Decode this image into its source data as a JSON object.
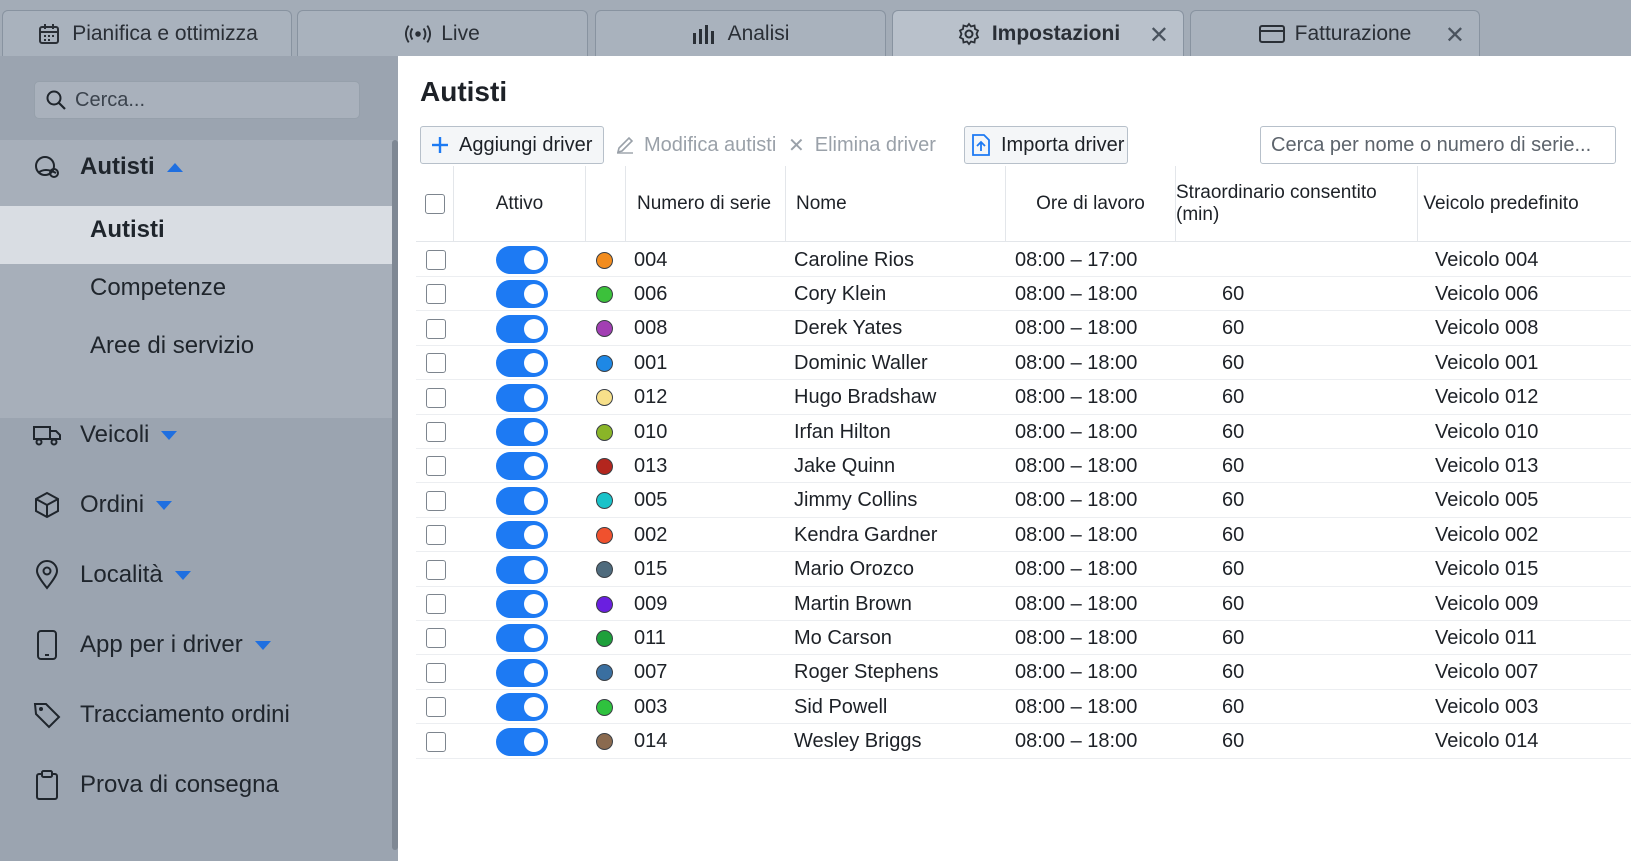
{
  "tabs": [
    {
      "label": "Pianifica e ottimizza",
      "icon": "calendar-icon",
      "closable": false
    },
    {
      "label": "Live",
      "icon": "broadcast-icon",
      "closable": false
    },
    {
      "label": "Analisi",
      "icon": "bar-chart-icon",
      "closable": false
    },
    {
      "label": "Impostazioni",
      "icon": "gear-icon",
      "closable": true,
      "active": true
    },
    {
      "label": "Fatturazione",
      "icon": "credit-card-icon",
      "closable": true
    }
  ],
  "sidebar": {
    "search_placeholder": "Cerca...",
    "group": {
      "label": "Autisti",
      "icon": "drivers-icon",
      "expanded": true
    },
    "sub_items": [
      {
        "label": "Autisti",
        "active": true
      },
      {
        "label": "Competenze"
      },
      {
        "label": "Aree di servizio"
      }
    ],
    "items": [
      {
        "label": "Veicoli",
        "icon": "truck-icon",
        "has_caret": true
      },
      {
        "label": "Ordini",
        "icon": "box-icon",
        "has_caret": true
      },
      {
        "label": "Località",
        "icon": "location-pin-icon",
        "has_caret": true
      },
      {
        "label": "App per i driver",
        "icon": "phone-icon",
        "has_caret": true
      },
      {
        "label": "Tracciamento ordini",
        "icon": "tag-icon",
        "has_caret": false
      },
      {
        "label": "Prova di consegna",
        "icon": "clipboard-icon",
        "has_caret": false
      }
    ]
  },
  "main": {
    "title": "Autisti",
    "toolbar": {
      "add_label": "Aggiungi driver",
      "edit_label": "Modifica autisti",
      "delete_label": "Elimina driver",
      "import_label": "Importa driver",
      "search_placeholder": "Cerca per nome o numero di serie..."
    },
    "columns": {
      "active": "Attivo",
      "serial": "Numero di serie",
      "name": "Nome",
      "hours": "Ore di lavoro",
      "overtime": "Straordinario consentito (min)",
      "vehicle": "Veicolo predefinito"
    },
    "rows": [
      {
        "color": "#f28c1e",
        "serial": "004",
        "name": "Caroline Rios",
        "hours": "08:00 – 17:00",
        "overtime": "",
        "vehicle": "Veicolo 004"
      },
      {
        "color": "#3cc13b",
        "serial": "006",
        "name": "Cory Klein",
        "hours": "08:00 – 18:00",
        "overtime": "60",
        "vehicle": "Veicolo 006"
      },
      {
        "color": "#a23fb3",
        "serial": "008",
        "name": "Derek Yates",
        "hours": "08:00 – 18:00",
        "overtime": "60",
        "vehicle": "Veicolo 008"
      },
      {
        "color": "#1e88e5",
        "serial": "001",
        "name": "Dominic Waller",
        "hours": "08:00 – 18:00",
        "overtime": "60",
        "vehicle": "Veicolo 001"
      },
      {
        "color": "#f7e08a",
        "serial": "012",
        "name": "Hugo Bradshaw",
        "hours": "08:00 – 18:00",
        "overtime": "60",
        "vehicle": "Veicolo 012"
      },
      {
        "color": "#8ab528",
        "serial": "010",
        "name": "Irfan Hilton",
        "hours": "08:00 – 18:00",
        "overtime": "60",
        "vehicle": "Veicolo 010"
      },
      {
        "color": "#b3261e",
        "serial": "013",
        "name": "Jake Quinn",
        "hours": "08:00 – 18:00",
        "overtime": "60",
        "vehicle": "Veicolo 013"
      },
      {
        "color": "#19c2c9",
        "serial": "005",
        "name": "Jimmy Collins",
        "hours": "08:00 – 18:00",
        "overtime": "60",
        "vehicle": "Veicolo 005"
      },
      {
        "color": "#f0512e",
        "serial": "002",
        "name": "Kendra Gardner",
        "hours": "08:00 – 18:00",
        "overtime": "60",
        "vehicle": "Veicolo 002"
      },
      {
        "color": "#4f6b7d",
        "serial": "015",
        "name": "Mario Orozco",
        "hours": "08:00 – 18:00",
        "overtime": "60",
        "vehicle": "Veicolo 015"
      },
      {
        "color": "#6a1fe0",
        "serial": "009",
        "name": "Martin Brown",
        "hours": "08:00 – 18:00",
        "overtime": "60",
        "vehicle": "Veicolo 009"
      },
      {
        "color": "#1ea03b",
        "serial": "011",
        "name": "Mo Carson",
        "hours": "08:00 – 18:00",
        "overtime": "60",
        "vehicle": "Veicolo 011"
      },
      {
        "color": "#3a6fa0",
        "serial": "007",
        "name": "Roger Stephens",
        "hours": "08:00 – 18:00",
        "overtime": "60",
        "vehicle": "Veicolo 007"
      },
      {
        "color": "#2fc23e",
        "serial": "003",
        "name": "Sid Powell",
        "hours": "08:00 – 18:00",
        "overtime": "60",
        "vehicle": "Veicolo 003"
      },
      {
        "color": "#8a6a4f",
        "serial": "014",
        "name": "Wesley Briggs",
        "hours": "08:00 – 18:00",
        "overtime": "60",
        "vehicle": "Veicolo 014"
      }
    ]
  },
  "colors": {
    "accent": "#1d7af3",
    "sidebar_bg": "#9ba4b0",
    "active_sub_bg": "#d9dde3"
  }
}
